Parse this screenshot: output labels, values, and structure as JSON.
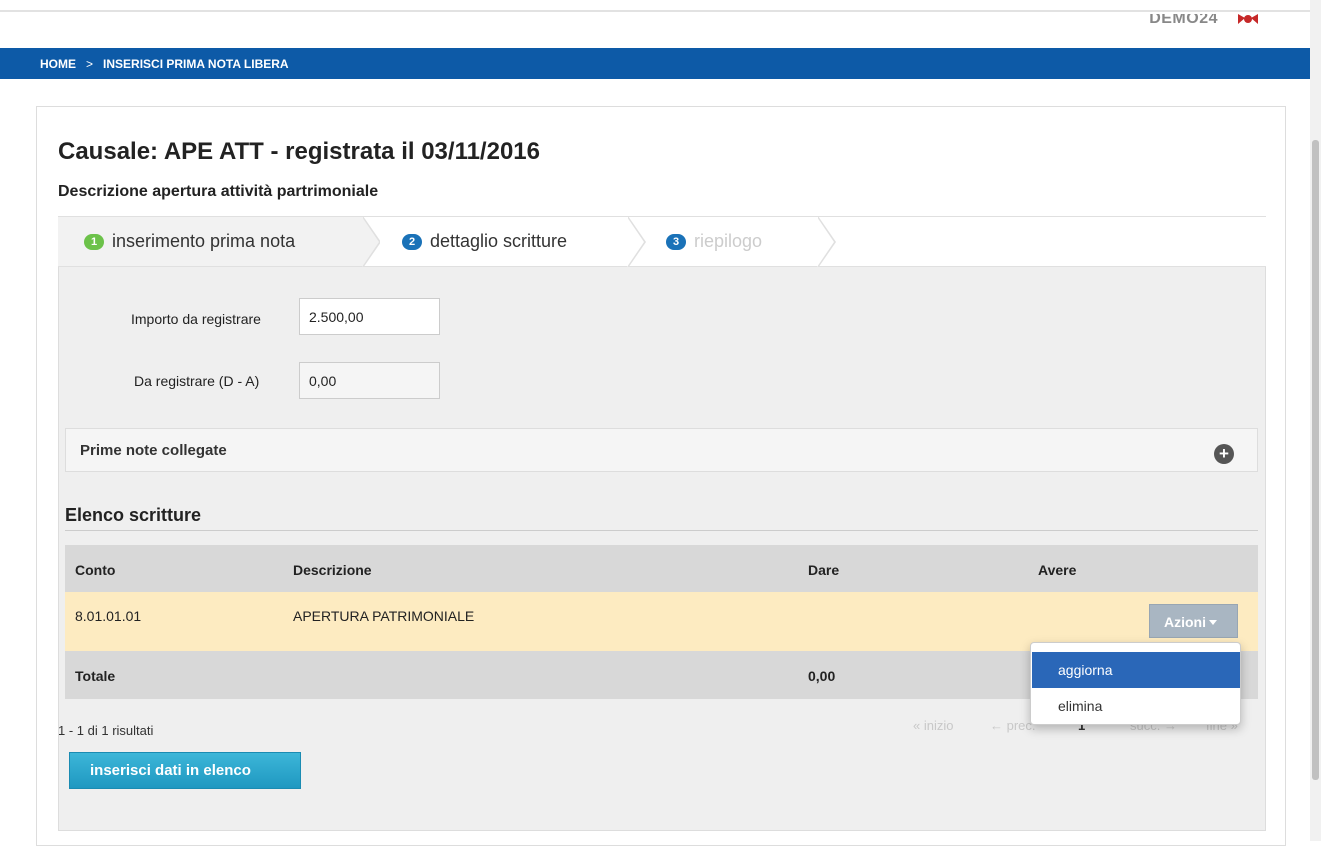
{
  "header": {
    "user": "DEMO24",
    "user_icon": "user-icon",
    "accent_color": "#c62828"
  },
  "breadcrumb": {
    "items": [
      "HOME",
      "INSERISCI PRIMA NOTA LIBERA"
    ],
    "separator": ">",
    "background": "#0d5aa7"
  },
  "page": {
    "title": "Causale: APE ATT - registrata il 03/11/2016",
    "subtitle": "Descrizione apertura attività partrimoniale"
  },
  "steps": [
    {
      "number": "1",
      "label": "inserimento prima nota",
      "state": "done",
      "color": "#6cc24a"
    },
    {
      "number": "2",
      "label": "dettaglio scritture",
      "state": "active",
      "color": "#1a72b8"
    },
    {
      "number": "3",
      "label": "riepilogo",
      "state": "disabled",
      "color": "#1a72b8"
    }
  ],
  "form": {
    "importo_label": "Importo da registrare",
    "importo_value": "2.500,00",
    "da_registrare_label": "Da registrare (D - A)",
    "da_registrare_value": "0,00"
  },
  "collapsible": {
    "label": "Prime note collegate",
    "icon": "plus-icon",
    "toggle_symbol": "+"
  },
  "table": {
    "section_title": "Elenco scritture",
    "columns": [
      "Conto",
      "Descrizione",
      "Dare",
      "Avere"
    ],
    "rows": [
      {
        "conto": "8.01.01.01",
        "descrizione": "APERTURA PATRIMONIALE",
        "dare": "",
        "avere": "",
        "actions_label": "Azioni"
      }
    ],
    "total_label": "Totale",
    "total_dare": "0,00",
    "row_highlight_color": "#fdebc1"
  },
  "dropdown": {
    "items": [
      "aggiorna",
      "elimina"
    ],
    "active_index": 0
  },
  "pagination": {
    "results": "1 - 1 di 1 risultati",
    "first": "« inizio",
    "prev": "← prec.",
    "page": "1",
    "next": "succ. →",
    "last": "fine »"
  },
  "buttons": {
    "insert": "inserisci dati in elenco"
  }
}
